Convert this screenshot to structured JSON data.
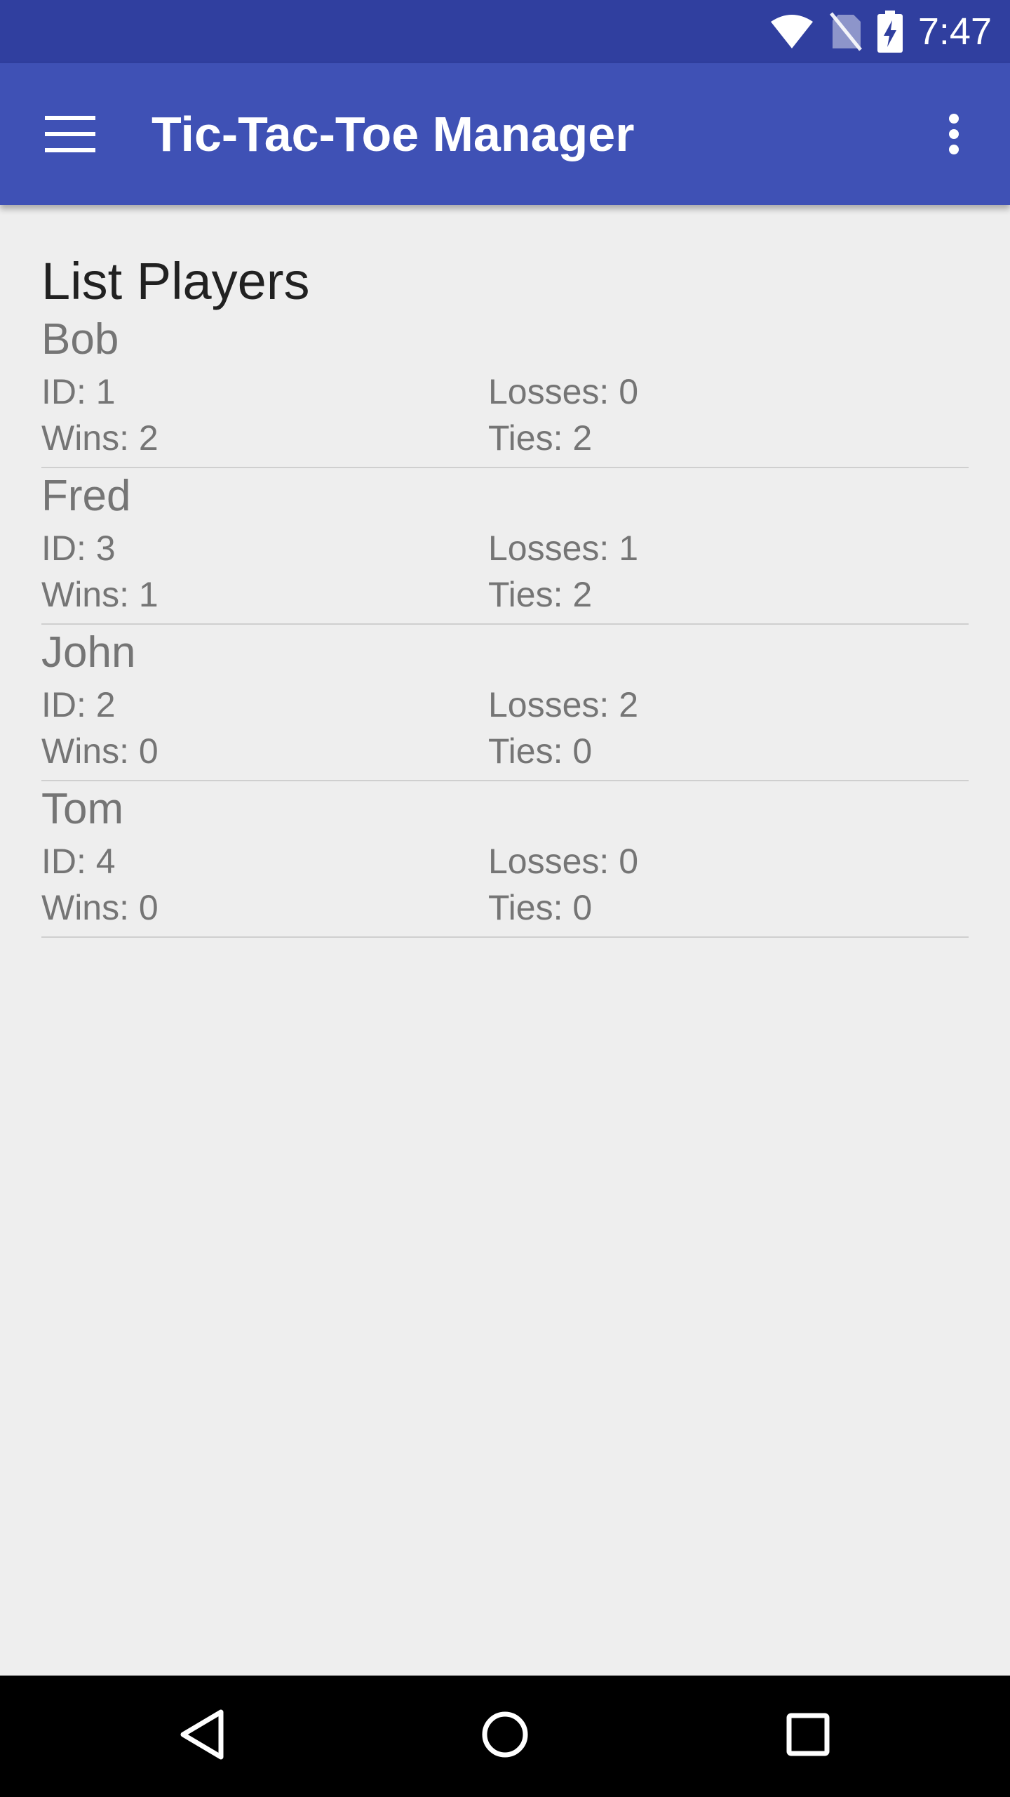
{
  "status_bar": {
    "time": "7:47",
    "icons": [
      "wifi-icon",
      "no-sim-icon",
      "battery-charging-icon"
    ]
  },
  "app_bar": {
    "title": "Tic-Tac-Toe Manager",
    "menu_icon": "hamburger-menu-icon",
    "overflow_icon": "more-vert-icon"
  },
  "main": {
    "heading": "List Players",
    "players": [
      {
        "name": "Bob",
        "id": "ID: 1",
        "wins": "Wins: 2",
        "losses": "Losses: 0",
        "ties": "Ties: 2"
      },
      {
        "name": "Fred",
        "id": "ID: 3",
        "wins": "Wins: 1",
        "losses": "Losses: 1",
        "ties": "Ties: 2"
      },
      {
        "name": "John",
        "id": "ID: 2",
        "wins": "Wins: 0",
        "losses": "Losses: 2",
        "ties": "Ties: 0"
      },
      {
        "name": "Tom",
        "id": "ID: 4",
        "wins": "Wins: 0",
        "losses": "Losses: 0",
        "ties": "Ties: 0"
      }
    ]
  },
  "nav_bar": {
    "icons": [
      "back-icon",
      "home-icon",
      "recents-icon"
    ]
  },
  "colors": {
    "status_bar": "#303f9f",
    "app_bar": "#3f51b5",
    "background": "#eeeeee",
    "text_primary": "#212121",
    "text_secondary": "#757575",
    "divider": "#cfcfcf"
  }
}
